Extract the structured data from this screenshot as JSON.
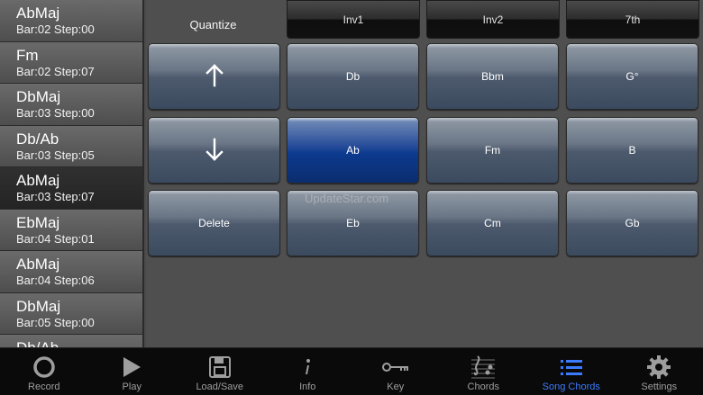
{
  "sidebar": {
    "items": [
      {
        "name": "AbMaj",
        "pos": "Bar:02 Step:00"
      },
      {
        "name": "Fm",
        "pos": "Bar:02 Step:07"
      },
      {
        "name": "DbMaj",
        "pos": "Bar:03 Step:00"
      },
      {
        "name": "Db/Ab",
        "pos": "Bar:03 Step:05"
      },
      {
        "name": "AbMaj",
        "pos": "Bar:03 Step:07"
      },
      {
        "name": "EbMaj",
        "pos": "Bar:04 Step:01"
      },
      {
        "name": "AbMaj",
        "pos": "Bar:04 Step:06"
      },
      {
        "name": "DbMaj",
        "pos": "Bar:05 Step:00"
      },
      {
        "name": "Db/Ab",
        "pos": ""
      }
    ],
    "selected_index": 4
  },
  "header": {
    "quantize_label": "Quantize",
    "buttons": [
      "Inv1",
      "Inv2",
      "7th"
    ]
  },
  "pads": {
    "up_icon": "arrow-up-icon",
    "down_icon": "arrow-down-icon",
    "delete_label": "Delete",
    "chords": [
      [
        "Db",
        "Bbm",
        "G°"
      ],
      [
        "Ab",
        "Fm",
        "B"
      ],
      [
        "Eb",
        "Cm",
        "Gb"
      ]
    ],
    "active": "Ab"
  },
  "watermark": "UpdateStar.com",
  "tabbar": {
    "tabs": [
      {
        "label": "Record",
        "icon": "record-icon"
      },
      {
        "label": "Play",
        "icon": "play-icon"
      },
      {
        "label": "Load/Save",
        "icon": "load-save-icon"
      },
      {
        "label": "Info",
        "icon": "info-icon"
      },
      {
        "label": "Key",
        "icon": "key-icon"
      },
      {
        "label": "Chords",
        "icon": "chords-icon"
      },
      {
        "label": "Song Chords",
        "icon": "list-icon"
      },
      {
        "label": "Settings",
        "icon": "gear-icon"
      }
    ],
    "active_index": 6,
    "active_color": "#3b7cff",
    "inactive_color": "#9e9e9e"
  }
}
